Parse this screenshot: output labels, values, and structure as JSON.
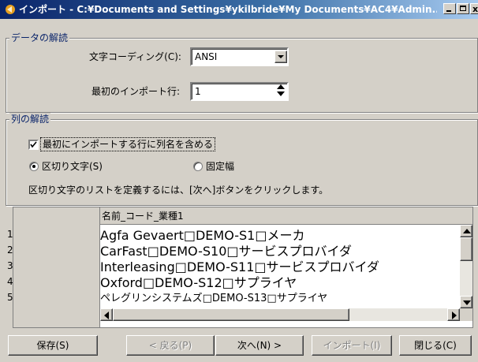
{
  "window": {
    "title": "インポート - C:¥Documents and Settings¥ykilbride¥My Documents¥AC4¥Admin..."
  },
  "data_group": {
    "legend": "データの解読",
    "encoding_label": "文字コーディング(C):",
    "encoding_value": "ANSI",
    "first_line_label": "最初のインポート行:",
    "first_line_value": "1"
  },
  "column_group": {
    "legend": "列の解読",
    "include_names_label": "最初にインポートする行に列名を含める",
    "include_names_checked": true,
    "delimited_label": "区切り文字(S)",
    "fixed_label": "固定幅",
    "selected_mode": "delimited",
    "instruction": "区切り文字のリストを定義するには、[次へ]ボタンをクリックします。"
  },
  "preview": {
    "column_header": "名前_コード_業種1",
    "rows": [
      {
        "num": "1",
        "text": "Agfa Gevaert□DEMO-S1□メーカ"
      },
      {
        "num": "2",
        "text": "CarFast□DEMO-S10□サービスプロバイダ"
      },
      {
        "num": "3",
        "text": "Interleasing□DEMO-S11□サービスプロバイダ"
      },
      {
        "num": "4",
        "text": "Oxford□DEMO-S12□サプライヤ"
      },
      {
        "num": "5",
        "text": "ペレグリンシステムズ□DEMO-S13□サプライヤ"
      }
    ]
  },
  "buttons": {
    "save": "保存(S)",
    "back": "< 戻る(P)",
    "next": "次へ(N) >",
    "import": "インポート(I)",
    "close": "閉じる(C)"
  },
  "colors": {
    "title_start": "#0a246a",
    "title_end": "#a6caf0",
    "face": "#d4d0c8",
    "group_legend": "#0a246a"
  }
}
